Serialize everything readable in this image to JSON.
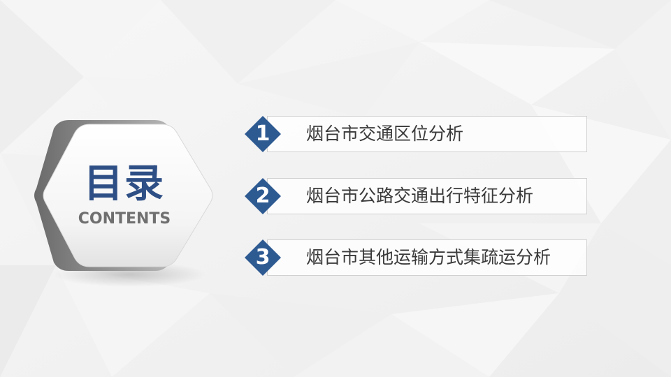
{
  "title": "目录",
  "subtitle": "CONTENTS",
  "items": [
    {
      "number": "1",
      "label": "烟台市交通区位分析"
    },
    {
      "number": "2",
      "label": "烟台市公路交通出行特征分析"
    },
    {
      "number": "3",
      "label": "烟台市其他运输方式集疏运分析"
    }
  ],
  "colors": {
    "accent": "#2e5a92",
    "title": "#2e4f86",
    "subtitle": "#6f6f6f",
    "text": "#3a3a3a",
    "background": "#f3f3f3"
  }
}
